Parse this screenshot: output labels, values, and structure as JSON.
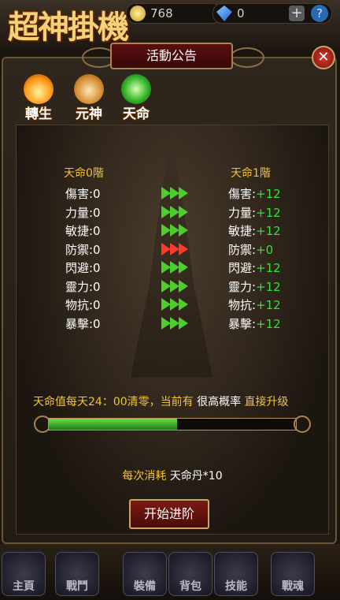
{
  "header": {
    "logo_text": "超神掛機",
    "coins": "768",
    "gems": "0",
    "plus_label": "+",
    "help_label": "?"
  },
  "dialog": {
    "title": "活動公告",
    "close_label": "✕",
    "tabs": [
      {
        "label": "轉生",
        "icon": "fire-icon"
      },
      {
        "label": "元神",
        "icon": "gourd-icon"
      },
      {
        "label": "天命",
        "icon": "jade-leaf-icon"
      }
    ],
    "left_header": "天命0階",
    "right_header": "天命1階",
    "stats": [
      {
        "left": "傷害:0",
        "right_label": "傷害:",
        "right_value": "+12",
        "arrow_color": "green"
      },
      {
        "left": "力量:0",
        "right_label": "力量:",
        "right_value": "+12",
        "arrow_color": "green"
      },
      {
        "left": "敏捷:0",
        "right_label": "敏捷:",
        "right_value": "+12",
        "arrow_color": "green"
      },
      {
        "left": "防禦:0",
        "right_label": "防禦:",
        "right_value": "+0",
        "arrow_color": "red"
      },
      {
        "left": "閃避:0",
        "right_label": "閃避:",
        "right_value": "+12",
        "arrow_color": "green"
      },
      {
        "left": "靈力:0",
        "right_label": "靈力:",
        "right_value": "+12",
        "arrow_color": "green"
      },
      {
        "left": "物抗:0",
        "right_label": "物抗:",
        "right_value": "+12",
        "arrow_color": "green"
      },
      {
        "left": "暴擊:0",
        "right_label": "暴擊:",
        "right_value": "+12",
        "arrow_color": "green"
      }
    ],
    "info_prefix": "天命值每天24：00清零，当前有",
    "info_highlight": "很高概率",
    "info_suffix": "直接升级",
    "progress": 0.52,
    "cost_label": "每次消耗",
    "cost_value": "天命丹*10",
    "start_button": "开始进阶"
  },
  "bottom_nav": [
    "主頁",
    "戰鬥",
    "裝備",
    "背包",
    "技能",
    "戰魂"
  ],
  "colors": {
    "accent_gold": "#f2c23a",
    "positive_green": "#36e03a",
    "panel_border": "#6b5436",
    "button_red": "#7a1a12"
  }
}
